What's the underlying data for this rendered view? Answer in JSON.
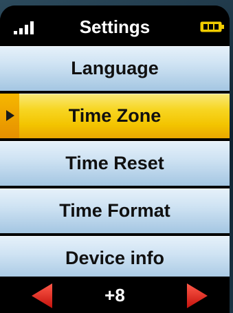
{
  "header": {
    "title": "Settings",
    "signal_icon": "signal-strength-icon",
    "battery_icon": "battery-icon",
    "battery_color": "#f2cc00"
  },
  "menu": {
    "items": [
      {
        "label": "Language",
        "selected": false
      },
      {
        "label": "Time Zone",
        "selected": true
      },
      {
        "label": "Time Reset",
        "selected": false
      },
      {
        "label": "Time Format",
        "selected": false
      },
      {
        "label": "Device info",
        "selected": false
      }
    ],
    "selected_color": "#f5cf10",
    "item_color": "#c4dcf0"
  },
  "footer": {
    "value": "+8",
    "prev_icon": "left-arrow-icon",
    "next_icon": "right-arrow-icon",
    "arrow_color": "#e0201a"
  }
}
